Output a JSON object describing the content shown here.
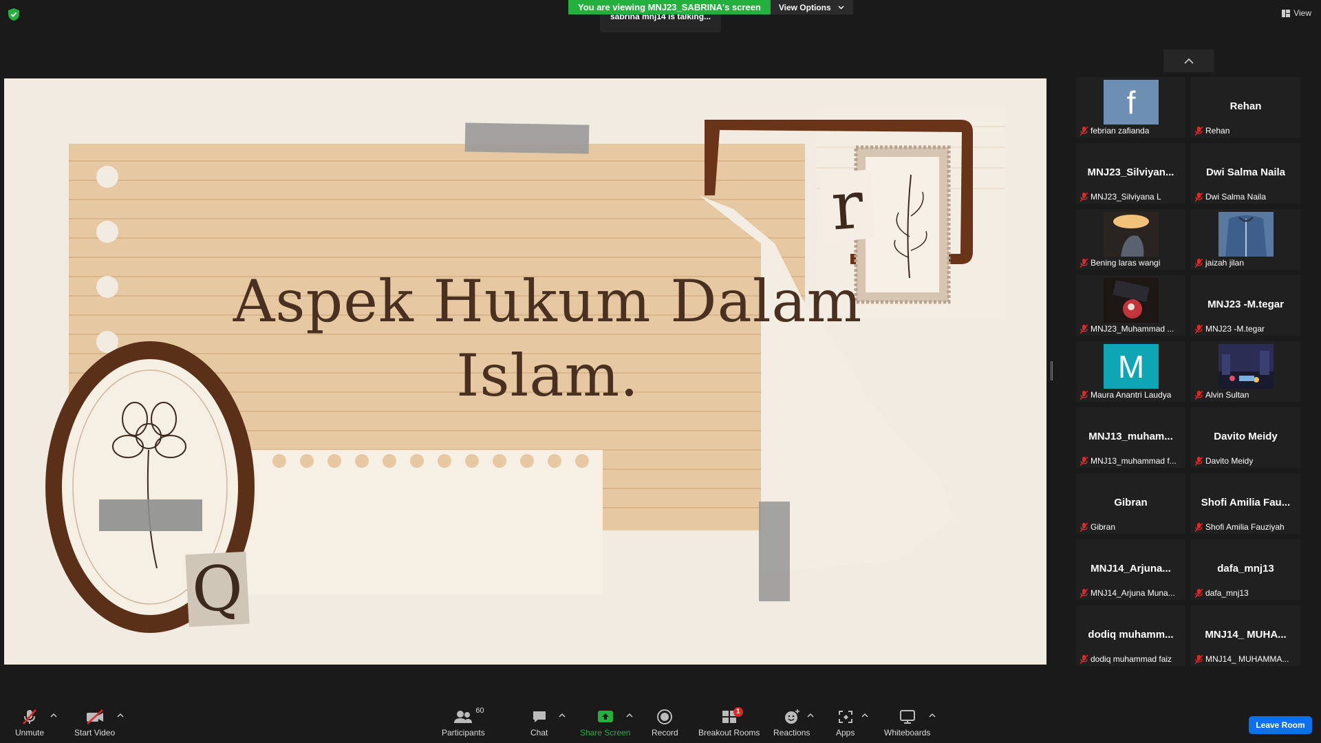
{
  "top": {
    "banner_text": "You are viewing MNJ23_SABRINA's screen",
    "view_options": "View Options",
    "talking": "sabrina mnj14 is talking...",
    "view": "View"
  },
  "slide": {
    "title_line1": "Aspek Hukum Dalam",
    "title_line2": "Islam.",
    "letter_r": "r",
    "letter_q": "Q"
  },
  "gallery": [
    {
      "big": "",
      "name": "febrian zafianda",
      "avatar": "f",
      "avatar_color": "#6d8fb3"
    },
    {
      "big": "Rehan",
      "name": "Rehan"
    },
    {
      "big": "MNJ23_Silviyan...",
      "name": "MNJ23_Silviyana L"
    },
    {
      "big": "Dwi Salma Naila",
      "name": "Dwi Salma Naila"
    },
    {
      "big": "",
      "name": "Bening laras wangi",
      "photo": "dark-room"
    },
    {
      "big": "",
      "name": "jaizah jilan",
      "photo": "denim"
    },
    {
      "big": "",
      "name": "MNJ23_Muhammad ...",
      "photo": "dark-red"
    },
    {
      "big": "MNJ23 -M.tegar",
      "name": "MNJ23 -M.tegar"
    },
    {
      "big": "",
      "name": "Maura Anantri Laudya",
      "avatar": "M",
      "avatar_color": "#0ea5b5"
    },
    {
      "big": "",
      "name": "Alvin Sultan",
      "photo": "city-night"
    },
    {
      "big": "MNJ13_muham...",
      "name": "MNJ13_muhammad f..."
    },
    {
      "big": "Davito Meidy",
      "name": "Davito Meidy"
    },
    {
      "big": "Gibran",
      "name": "Gibran"
    },
    {
      "big": "Shofi Amilia Fau...",
      "name": "Shofi Amilia Fauziyah"
    },
    {
      "big": "MNJ14_Arjuna...",
      "name": "MNJ14_Arjuna Muna..."
    },
    {
      "big": "dafa_mnj13",
      "name": "dafa_mnj13"
    },
    {
      "big": "dodiq muhamm...",
      "name": "dodiq muhammad faiz"
    },
    {
      "big": "MNJ14_ MUHA...",
      "name": "MNJ14_ MUHAMMA..."
    }
  ],
  "toolbar": {
    "unmute": "Unmute",
    "start_video": "Start Video",
    "participants": "Participants",
    "participants_count": "60",
    "chat": "Chat",
    "share_screen": "Share Screen",
    "record": "Record",
    "breakout_rooms": "Breakout Rooms",
    "breakout_badge": "1",
    "reactions": "Reactions",
    "apps": "Apps",
    "whiteboards": "Whiteboards",
    "leave": "Leave Room"
  },
  "colors": {
    "share_green": "#23b03d",
    "leave_blue": "#0e71eb",
    "mute_red": "#e02828",
    "slide_brown": "#5b3019"
  }
}
